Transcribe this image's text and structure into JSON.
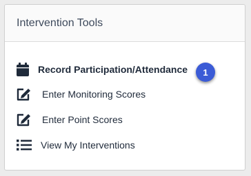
{
  "panel": {
    "title": "Intervention Tools",
    "items": [
      {
        "label": "Record Participation/Attendance",
        "icon": "calendar-icon"
      },
      {
        "label": "Enter Monitoring Scores",
        "icon": "edit-icon"
      },
      {
        "label": "Enter Point Scores",
        "icon": "edit-icon"
      },
      {
        "label": "View My Interventions",
        "icon": "list-icon"
      }
    ]
  },
  "callout": {
    "number": "1"
  },
  "colors": {
    "icon": "#1f2a3a",
    "badge": "#3b5bd6"
  }
}
